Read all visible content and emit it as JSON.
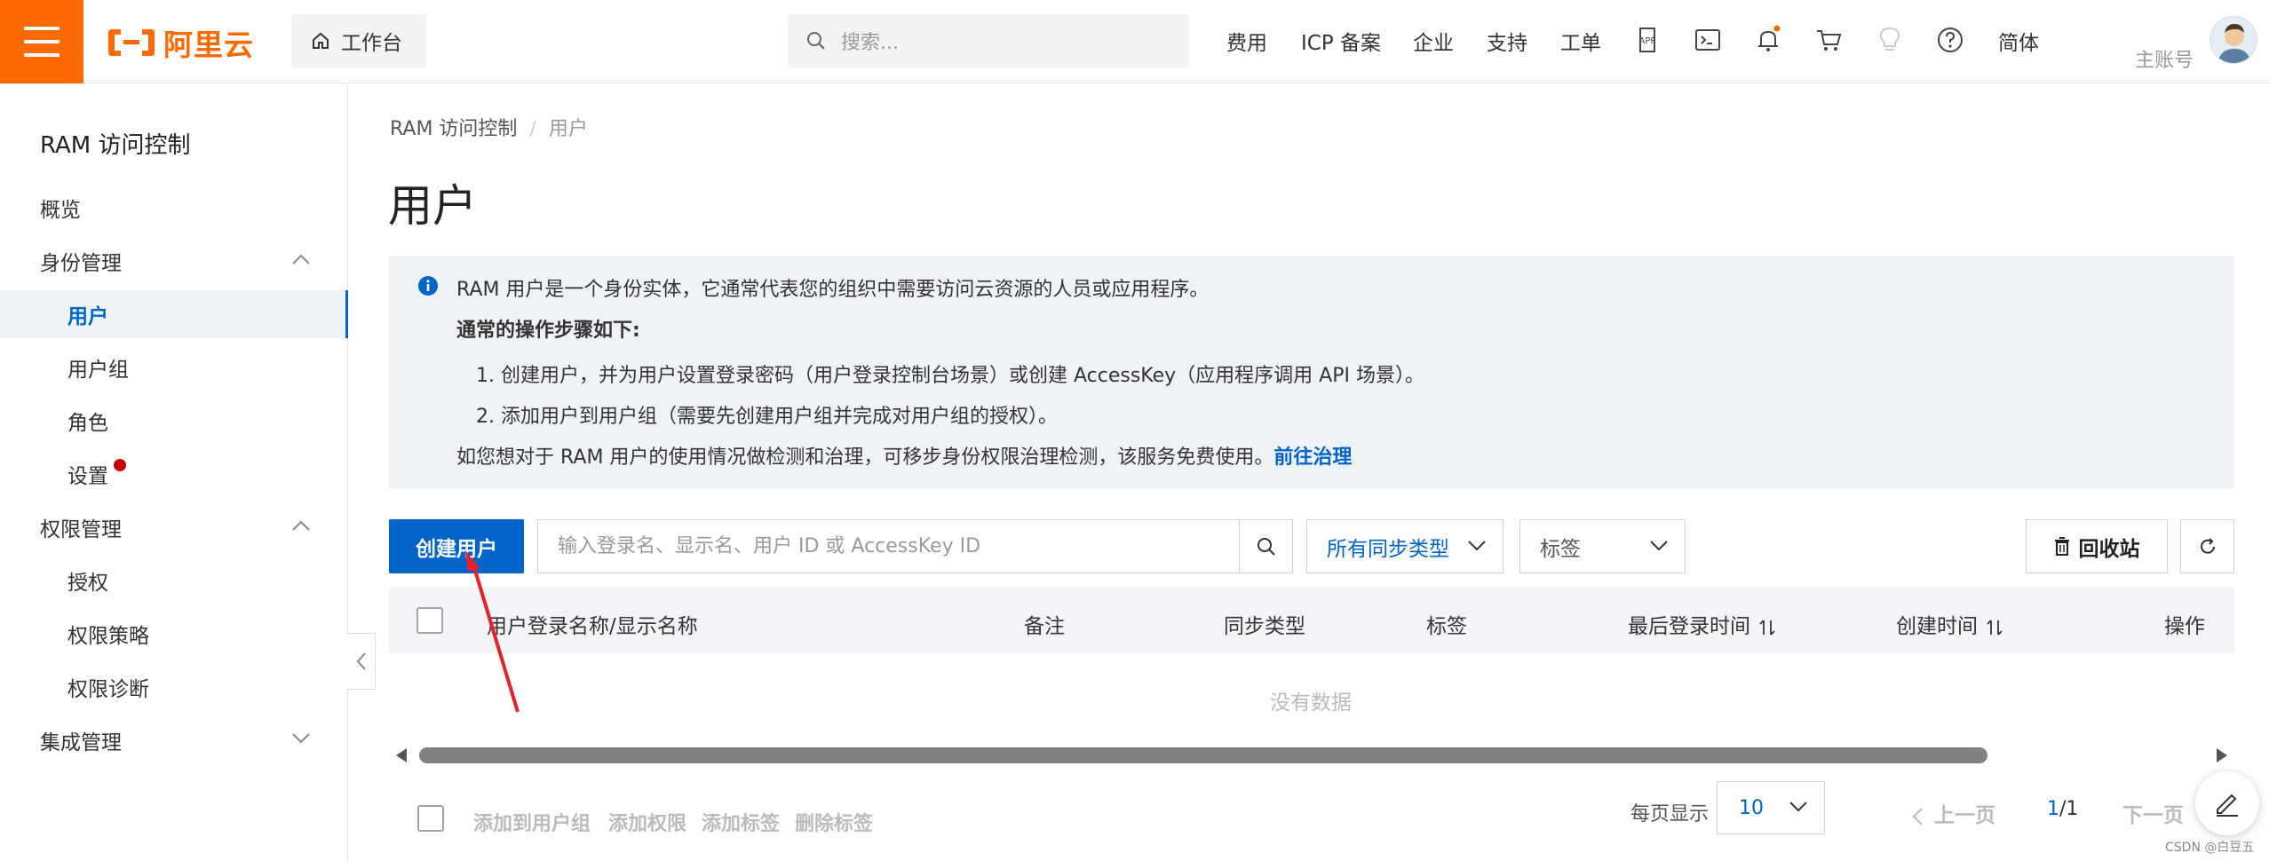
{
  "brand": {
    "logo_text": "阿里云",
    "accent_color": "#ff6a00",
    "primary_color": "#0064c8"
  },
  "topbar": {
    "workbench_label": "工作台",
    "search_placeholder": "搜索...",
    "nav": [
      "费用",
      "ICP 备案",
      "企业",
      "支持",
      "工单"
    ],
    "icons": [
      "app-icon",
      "terminal-icon",
      "bell-icon",
      "cart-icon",
      "lightbulb-icon",
      "help-icon"
    ],
    "language": "简体",
    "account_label": "主账号"
  },
  "sidebar": {
    "title": "RAM 访问控制",
    "items": [
      {
        "label": "概览",
        "level": 1
      },
      {
        "label": "身份管理",
        "level": 1,
        "expandable": true,
        "expanded": true
      },
      {
        "label": "用户",
        "level": 2,
        "active": true
      },
      {
        "label": "用户组",
        "level": 2
      },
      {
        "label": "角色",
        "level": 2
      },
      {
        "label": "设置",
        "level": 2,
        "badge": "red-dot"
      },
      {
        "label": "权限管理",
        "level": 1,
        "expandable": true,
        "expanded": true
      },
      {
        "label": "授权",
        "level": 2
      },
      {
        "label": "权限策略",
        "level": 2
      },
      {
        "label": "权限诊断",
        "level": 2
      },
      {
        "label": "集成管理",
        "level": 1,
        "expandable": true,
        "expanded": false
      }
    ]
  },
  "breadcrumb": {
    "root": "RAM 访问控制",
    "separator": "/",
    "current": "用户"
  },
  "page_title": "用户",
  "info": {
    "line1": "RAM 用户是一个身份实体，它通常代表您的组织中需要访问云资源的人员或应用程序。",
    "steps_title": "通常的操作步骤如下:",
    "step1": "1. 创建用户，并为用户设置登录密码（用户登录控制台场景）或创建 AccessKey（应用程序调用 API 场景）。",
    "step2": "2. 添加用户到用户组（需要先创建用户组并完成对用户组的授权）。",
    "footer": "如您想对于 RAM 用户的使用情况做检测和治理，可移步身份权限治理检测，该服务免费使用。",
    "footer_link": "前往治理"
  },
  "toolbar": {
    "create_user": "创建用户",
    "search_placeholder": "输入登录名、显示名、用户 ID 或 AccessKey ID",
    "sync_type_value": "所有同步类型",
    "tag_value": "标签",
    "recycle_bin": "回收站"
  },
  "table": {
    "columns": [
      "用户登录名称/显示名称",
      "备注",
      "同步类型",
      "标签",
      "最后登录时间",
      "创建时间",
      "操作"
    ],
    "sortable": [
      "最后登录时间",
      "创建时间"
    ],
    "rows": [],
    "empty_text": "没有数据"
  },
  "bulk_actions": [
    "添加到用户组",
    "添加权限",
    "添加标签",
    "删除标签"
  ],
  "pagination": {
    "per_page_label": "每页显示",
    "per_page": "10",
    "prev": "上一页",
    "current": "1",
    "total": "/1",
    "next": "下一页"
  },
  "watermark": "CSDN @白豆五"
}
